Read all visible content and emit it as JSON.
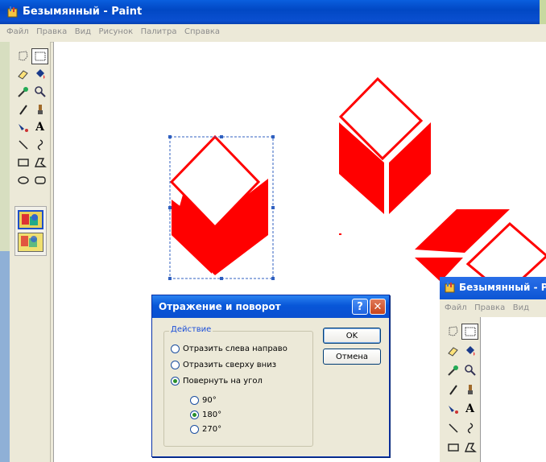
{
  "window": {
    "title": "Безымянный - Paint",
    "menu": [
      "Файл",
      "Правка",
      "Вид",
      "Рисунок",
      "Палитра",
      "Справка"
    ]
  },
  "dialog": {
    "title": "Отражение и поворот",
    "group_label": "Действие",
    "options": [
      {
        "label": "Отразить слева направо",
        "selected": false
      },
      {
        "label": "Отразить сверху вниз",
        "selected": false
      },
      {
        "label": "Повернуть на угол",
        "selected": true
      }
    ],
    "angles": [
      {
        "label": "90°",
        "selected": false
      },
      {
        "label": "180°",
        "selected": true
      },
      {
        "label": "270°",
        "selected": false
      }
    ],
    "ok_label": "OK",
    "cancel_label": "Отмена",
    "help_glyph": "?",
    "close_glyph": "✕"
  },
  "window2": {
    "title": "Безымянный - Р",
    "menu": [
      "Файл",
      "Правка",
      "Вид"
    ]
  },
  "colors": {
    "drawing_red": "#ff0000",
    "selection_blue": "#3060c0",
    "titlebar_blue": "#0a4fd0"
  }
}
